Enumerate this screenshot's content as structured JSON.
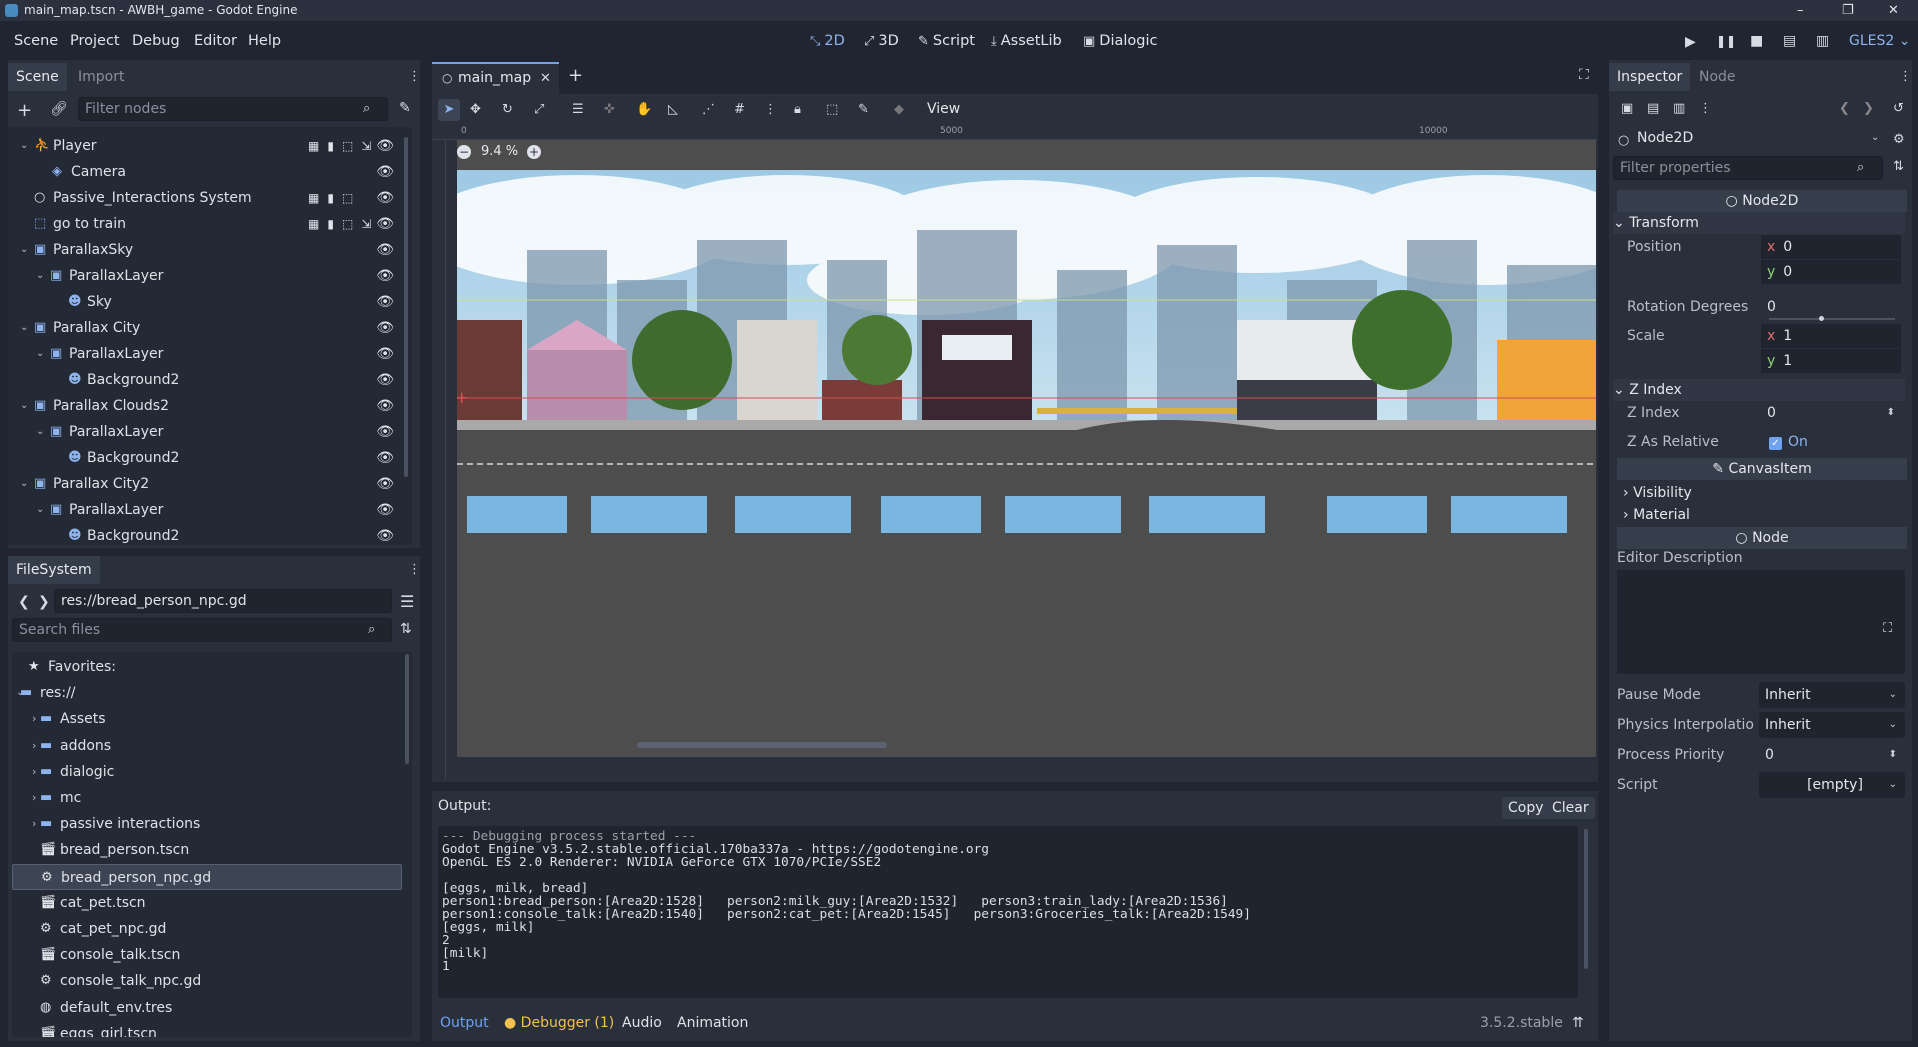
{
  "window": {
    "title": "main_map.tscn - AWBH_game - Godot Engine",
    "minimize": "–",
    "maximize": "❐",
    "close": "✕"
  },
  "menus": [
    "Scene",
    "Project",
    "Debug",
    "Editor",
    "Help"
  ],
  "modes": [
    "2D",
    "3D",
    "Script",
    "AssetLib",
    "Dialogic"
  ],
  "renderer": "GLES2",
  "scene_dock": {
    "tabs": [
      "Scene",
      "Import"
    ],
    "filter_placeholder": "Filter nodes",
    "tree": [
      {
        "label": "Player",
        "icon": "kinematic-icon"
      },
      {
        "label": "Camera",
        "icon": "camera-icon"
      },
      {
        "label": "Passive_Interactions System",
        "icon": "node-circle-icon"
      },
      {
        "label": "go to train",
        "icon": "area-icon"
      },
      {
        "label": "ParallaxSky",
        "icon": "parallax-icon"
      },
      {
        "label": "ParallaxLayer",
        "icon": "parallax-layer-icon"
      },
      {
        "label": "Sky",
        "icon": "sprite-icon"
      },
      {
        "label": "Parallax City",
        "icon": "parallax-icon"
      },
      {
        "label": "ParallaxLayer",
        "icon": "parallax-layer-icon"
      },
      {
        "label": "Background2",
        "icon": "sprite-icon"
      },
      {
        "label": "Parallax Clouds2",
        "icon": "parallax-icon"
      },
      {
        "label": "ParallaxLayer",
        "icon": "parallax-layer-icon"
      },
      {
        "label": "Background2",
        "icon": "sprite-icon"
      },
      {
        "label": "Parallax City2",
        "icon": "parallax-icon"
      },
      {
        "label": "ParallaxLayer",
        "icon": "parallax-layer-icon"
      },
      {
        "label": "Background2",
        "icon": "sprite-icon"
      }
    ]
  },
  "filesystem": {
    "tab": "FileSystem",
    "path": "res://bread_person_npc.gd",
    "search_placeholder": "Search files",
    "items": [
      {
        "label": "Favorites:",
        "type": "favorites"
      },
      {
        "label": "res://",
        "type": "root"
      },
      {
        "label": "Assets",
        "type": "folder"
      },
      {
        "label": "addons",
        "type": "folder"
      },
      {
        "label": "dialogic",
        "type": "folder"
      },
      {
        "label": "mc",
        "type": "folder"
      },
      {
        "label": "passive interactions",
        "type": "folder"
      },
      {
        "label": "bread_person.tscn",
        "type": "scene"
      },
      {
        "label": "bread_person_npc.gd",
        "type": "script"
      },
      {
        "label": "cat_pet.tscn",
        "type": "scene"
      },
      {
        "label": "cat_pet_npc.gd",
        "type": "script"
      },
      {
        "label": "console_talk.tscn",
        "type": "scene"
      },
      {
        "label": "console_talk_npc.gd",
        "type": "script"
      },
      {
        "label": "default_env.tres",
        "type": "resource"
      },
      {
        "label": "eggs_girl.tscn",
        "type": "scene"
      }
    ]
  },
  "viewport": {
    "tab": "main_map",
    "zoom": "9.4 %",
    "view_menu": "View",
    "ruler": [
      "0",
      "5000",
      "10000"
    ]
  },
  "output": {
    "label": "Output:",
    "copy": "Copy",
    "clear": "Clear",
    "lines": [
      "--- Debugging process started ---",
      "Godot Engine v3.5.2.stable.official.170ba337a - https://godotengine.org",
      "OpenGL ES 2.0 Renderer: NVIDIA GeForce GTX 1070/PCIe/SSE2",
      "",
      "[eggs, milk, bread]",
      "person1:bread_person:[Area2D:1528]   person2:milk_guy:[Area2D:1532]   person3:train_lady:[Area2D:1536]",
      "person1:console_talk:[Area2D:1540]   person2:cat_pet:[Area2D:1545]   person3:Groceries_talk:[Area2D:1549]",
      "[eggs, milk]",
      "2",
      "[milk]",
      "1"
    ],
    "bottom_tabs": [
      "Output",
      "Debugger (1)",
      "Audio",
      "Animation"
    ],
    "version": "3.5.2.stable"
  },
  "inspector": {
    "tabs": [
      "Inspector",
      "Node"
    ],
    "node_type": "Node2D",
    "filter_placeholder": "Filter properties",
    "class_header": "Node2D",
    "transform": "Transform",
    "position_label": "Position",
    "position_x": "0",
    "position_y": "0",
    "rotation_label": "Rotation Degrees",
    "rotation": "0",
    "scale_label": "Scale",
    "scale_x": "1",
    "scale_y": "1",
    "zindex_group": "Z Index",
    "zindex_label": "Z Index",
    "zindex": "0",
    "zrel_label": "Z As Relative",
    "zrel": "On",
    "canvasitem": "CanvasItem",
    "visibility": "Visibility",
    "material": "Material",
    "node_header": "Node",
    "editor_desc": "Editor Description",
    "pause_label": "Pause Mode",
    "pause": "Inherit",
    "physics_label": "Physics Interpolatio",
    "physics": "Inherit",
    "priority_label": "Process Priority",
    "priority": "0",
    "script_label": "Script",
    "script": "[empty]"
  }
}
